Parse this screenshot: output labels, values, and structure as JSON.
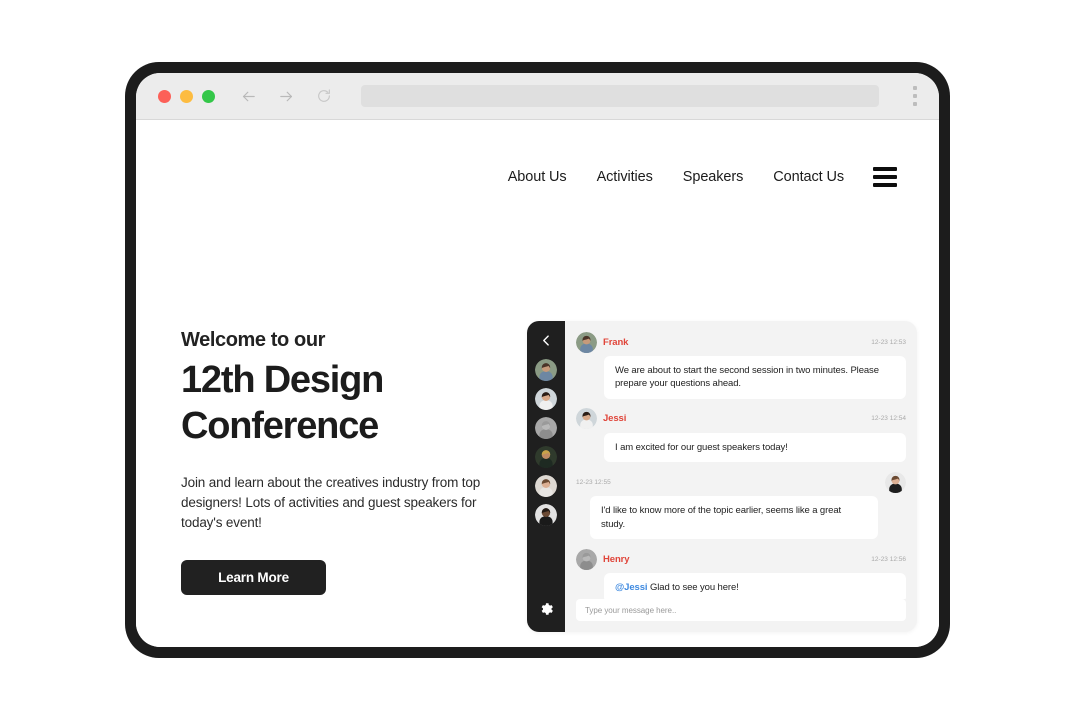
{
  "browser": {
    "traffic_lights": [
      "close",
      "minimize",
      "maximize"
    ],
    "back_label": "Back",
    "forward_label": "Forward",
    "reload_label": "Reload",
    "address_value": "",
    "menu_label": "Menu"
  },
  "nav": {
    "links": [
      {
        "label": "About Us"
      },
      {
        "label": "Activities"
      },
      {
        "label": "Speakers"
      },
      {
        "label": "Contact Us"
      }
    ],
    "menu_icon": "hamburger-icon"
  },
  "hero": {
    "eyebrow": "Welcome to our",
    "title_line1": "12th Design",
    "title_line2": "Conference",
    "body": "Join and learn about the creatives industry from top designers! Lots of activities and guest speakers for today's event!",
    "cta_label": "Learn More"
  },
  "chat": {
    "back_icon": "chevron-left-icon",
    "settings_icon": "gear-icon",
    "rail_members": [
      {
        "name": "member-1",
        "skin": "#c79a7a",
        "hair": "#4a3428",
        "shirt": "#6d87a3",
        "bg": "#8b9b85"
      },
      {
        "name": "member-2",
        "skin": "#d8a888",
        "hair": "#2b1d16",
        "shirt": "#f0f0f0",
        "bg": "#cfd6da"
      },
      {
        "name": "member-3",
        "skin": "#b9b9b9",
        "hair": "#9a9a9a",
        "shirt": "#8d8d8d",
        "bg": "#a8a8a8"
      },
      {
        "name": "member-4",
        "skin": "#c08b63",
        "hair": "#c9a24a",
        "shirt": "#1e2a22",
        "bg": "#2f3a2c"
      },
      {
        "name": "member-5",
        "skin": "#dcb094",
        "hair": "#6b4a32",
        "shirt": "#e8e6e3",
        "bg": "#ddd8d2"
      },
      {
        "name": "member-6",
        "skin": "#6b4a34",
        "hair": "#231a14",
        "shirt": "#1a1a1a",
        "bg": "#e2e2e2"
      }
    ],
    "messages": [
      {
        "author": "Frank",
        "time": "12-23 12:53",
        "text": "We are about to start the second session in two minutes. Please prepare your questions ahead.",
        "self": false,
        "avatar": {
          "skin": "#c79a7a",
          "hair": "#4a3428",
          "shirt": "#6d87a3",
          "bg": "#8b9b85"
        }
      },
      {
        "author": "Jessi",
        "time": "12-23 12:54",
        "text": "I am excited for our guest speakers today!",
        "self": false,
        "avatar": {
          "skin": "#d8a888",
          "hair": "#2b1d16",
          "shirt": "#f0f0f0",
          "bg": "#cfd6da"
        }
      },
      {
        "author": "",
        "time": "12-23 12:55",
        "text": "I'd like to know more of the topic earlier, seems like a great study.",
        "self": true,
        "avatar": {
          "skin": "#dcb094",
          "hair": "#6b4a32",
          "shirt": "#1e1e1e",
          "bg": "#e8e8e8"
        }
      },
      {
        "author": "Henry",
        "time": "12-23 12:56",
        "mention": "@Jessi",
        "text": " Glad to see you here!",
        "self": false,
        "avatar": {
          "skin": "#b9b9b9",
          "hair": "#9a9a9a",
          "shirt": "#8d8d8d",
          "bg": "#a8a8a8"
        }
      }
    ],
    "input_placeholder": "Type your message here..",
    "input_value": ""
  },
  "colors": {
    "accent_name": "#e0453a",
    "mention": "#3f8ae0",
    "dark": "#1f1f1f",
    "panel": "#f3f3f3"
  }
}
